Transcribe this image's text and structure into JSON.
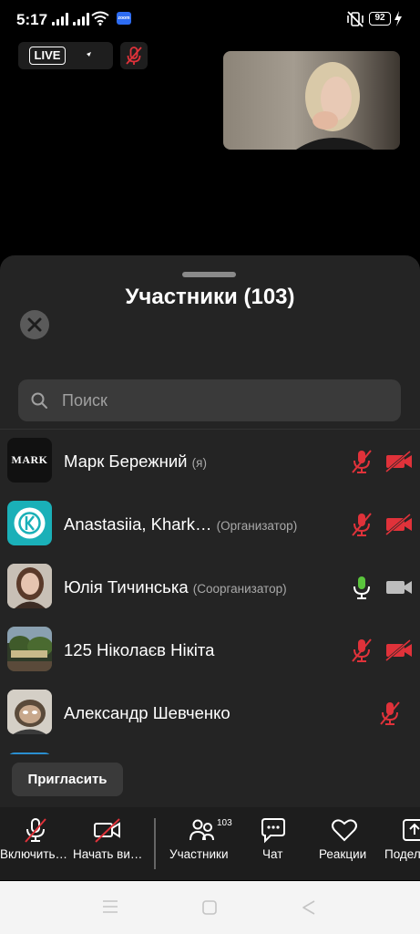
{
  "status_bar": {
    "time": "5:17",
    "battery": "92",
    "zoom_badge": "zoom"
  },
  "meeting": {
    "live_label": "LIVE"
  },
  "sheet": {
    "title": "Участники (103)",
    "search_placeholder": "Поиск",
    "participants": [
      {
        "name": "Марк Бережний",
        "role": "(я)",
        "avatar_text": "MARK",
        "mic": "muted",
        "camera": "off"
      },
      {
        "name": "Anastasiia, Khark…",
        "role": "(Организатор)",
        "avatar_text": "",
        "mic": "muted",
        "camera": "off"
      },
      {
        "name": "Юлія Тичинська",
        "role": "(Соорганизатор)",
        "avatar_text": "",
        "mic": "on",
        "camera": "on"
      },
      {
        "name": "125 Ніколаєв Нікіта",
        "role": "",
        "avatar_text": "",
        "mic": "muted",
        "camera": "off"
      },
      {
        "name": "Александр Шевченко",
        "role": "",
        "avatar_text": "",
        "mic": "muted",
        "camera": "none"
      }
    ],
    "invite_label": "Пригласить"
  },
  "toolbar": {
    "unmute_label": "Включить…",
    "start_video_label": "Начать ви…",
    "participants_label": "Участники",
    "participants_count": "103",
    "chat_label": "Чат",
    "reactions_label": "Реакции",
    "share_label": "Подел"
  },
  "colors": {
    "muted_red": "#e0323a",
    "mic_on_green": "#5ac43c",
    "sheet_bg": "#242424",
    "toolbar_bg": "#1d1d1d"
  }
}
